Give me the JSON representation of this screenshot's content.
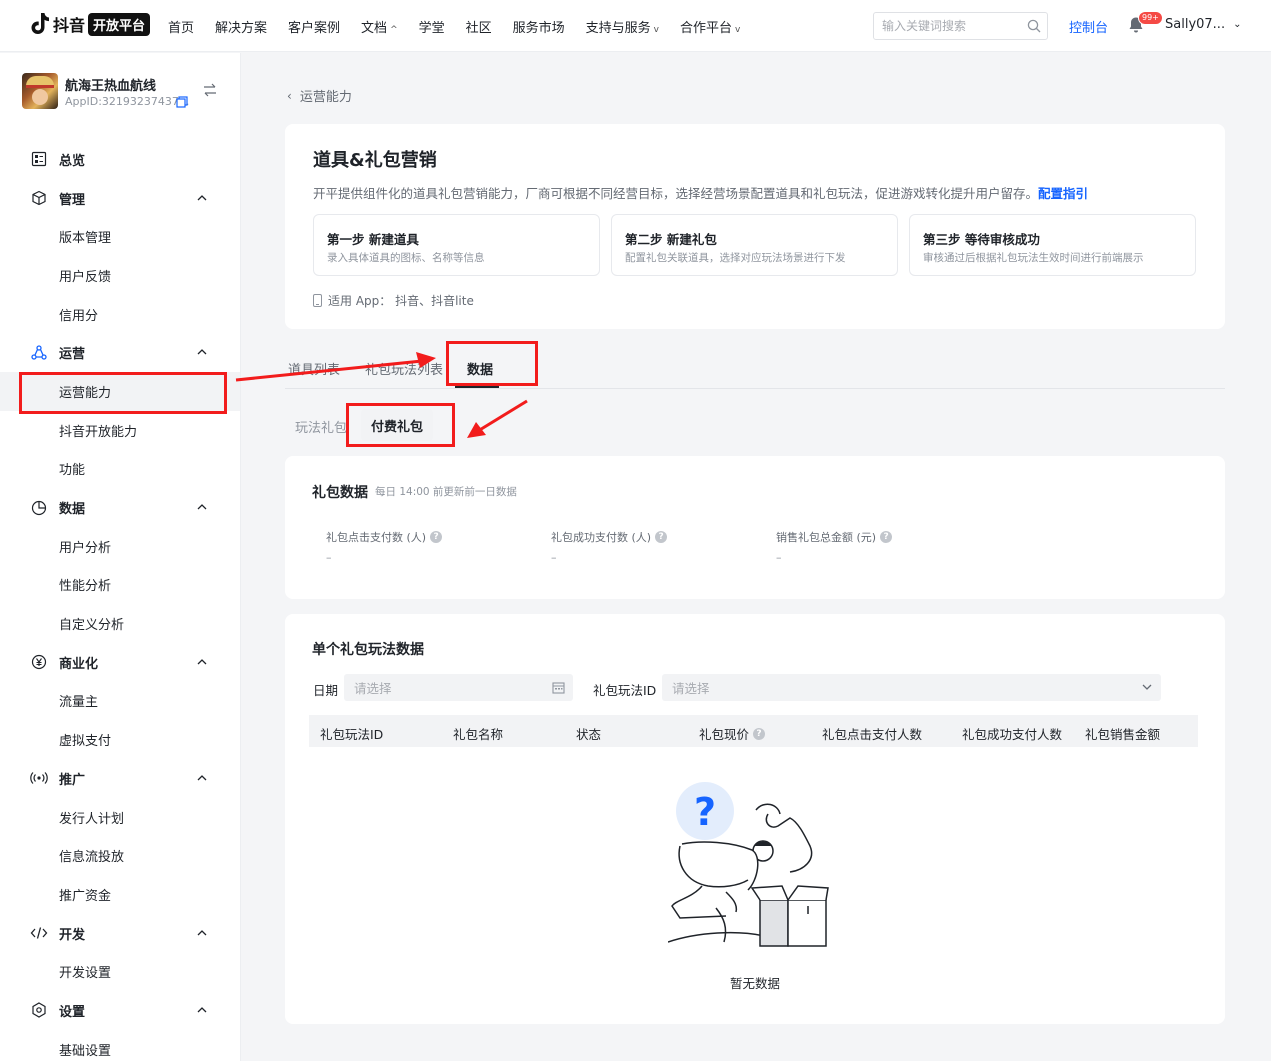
{
  "topnav": {
    "logo_text": "抖音",
    "logo_badge": "开放平台",
    "items": [
      {
        "label": "首页",
        "caret": ""
      },
      {
        "label": "解决方案",
        "caret": ""
      },
      {
        "label": "客户案例",
        "caret": ""
      },
      {
        "label": "文档",
        "caret": "^"
      },
      {
        "label": "学堂",
        "caret": ""
      },
      {
        "label": "社区",
        "caret": ""
      },
      {
        "label": "服务市场",
        "caret": ""
      },
      {
        "label": "支持与服务",
        "caret": "v"
      },
      {
        "label": "合作平台",
        "caret": "v"
      }
    ],
    "search_placeholder": "输入关键词搜索",
    "console": "控制台",
    "notify_badge": "99+",
    "user": "Sally07..."
  },
  "sidebar": {
    "app_name": "航海王热血航线",
    "app_id": "AppID:32193237437...",
    "groups": [
      {
        "label": "总览",
        "icon": "overview-icon",
        "chevron": false,
        "items": []
      },
      {
        "label": "管理",
        "icon": "cube-icon",
        "chevron": true,
        "items": [
          "版本管理",
          "用户反馈",
          "信用分"
        ]
      },
      {
        "label": "运营",
        "icon": "operations-icon",
        "chevron": true,
        "items": [
          "运营能力",
          "抖音开放能力",
          "功能"
        ]
      },
      {
        "label": "数据",
        "icon": "pie-chart-icon",
        "chevron": true,
        "items": [
          "用户分析",
          "性能分析",
          "自定义分析"
        ]
      },
      {
        "label": "商业化",
        "icon": "yuan-icon",
        "chevron": true,
        "items": [
          "流量主",
          "虚拟支付"
        ]
      },
      {
        "label": "推广",
        "icon": "broadcast-icon",
        "chevron": true,
        "items": [
          "发行人计划",
          "信息流投放",
          "推广资金"
        ]
      },
      {
        "label": "开发",
        "icon": "code-icon",
        "chevron": true,
        "items": [
          "开发设置"
        ]
      },
      {
        "label": "设置",
        "icon": "settings-icon",
        "chevron": true,
        "items": [
          "基础设置"
        ]
      }
    ],
    "active_item": "运营能力"
  },
  "back_label": "运营能力",
  "intro": {
    "title": "道具&礼包营销",
    "desc": "开平提供组件化的道具礼包营销能力，厂商可根据不同经营目标，选择经营场景配置道具和礼包玩法，促进游戏转化提升用户留存。",
    "desc_link": "配置指引",
    "steps": [
      {
        "title": "第一步 新建道具",
        "desc": "录入具体道具的图标、名称等信息"
      },
      {
        "title": "第二步 新建礼包",
        "desc": "配置礼包关联道具，选择对应玩法场景进行下发"
      },
      {
        "title": "第三步 等待审核成功",
        "desc": "审核通过后根据礼包玩法生效时间进行前端展示"
      }
    ],
    "applies": "适用 App： 抖音、抖音lite"
  },
  "tabs": [
    "道具列表",
    "礼包玩法列表",
    "数据"
  ],
  "active_tab": "数据",
  "subtabs": [
    "玩法礼包",
    "付费礼包"
  ],
  "active_subtab": "付费礼包",
  "gift_data": {
    "title": "礼包数据",
    "subtitle": "每日 14:00 前更新前一日数据",
    "metrics": [
      {
        "label": "礼包点击支付数 (人)",
        "value": "–"
      },
      {
        "label": "礼包成功支付数 (人)",
        "value": "–"
      },
      {
        "label": "销售礼包总金额 (元)",
        "value": "–"
      }
    ]
  },
  "single": {
    "title": "单个礼包玩法数据",
    "date_label": "日期",
    "date_placeholder": "请选择",
    "id_label": "礼包玩法ID",
    "id_placeholder": "请选择",
    "columns": [
      "礼包玩法ID",
      "礼包名称",
      "状态",
      "礼包现价",
      "礼包点击支付人数",
      "礼包成功支付人数",
      "礼包销售金额"
    ],
    "empty_text": "暂无数据"
  },
  "colors": {
    "accent": "#1664ff",
    "annotation": "#f21c1c",
    "bg": "#f4f5f7"
  }
}
